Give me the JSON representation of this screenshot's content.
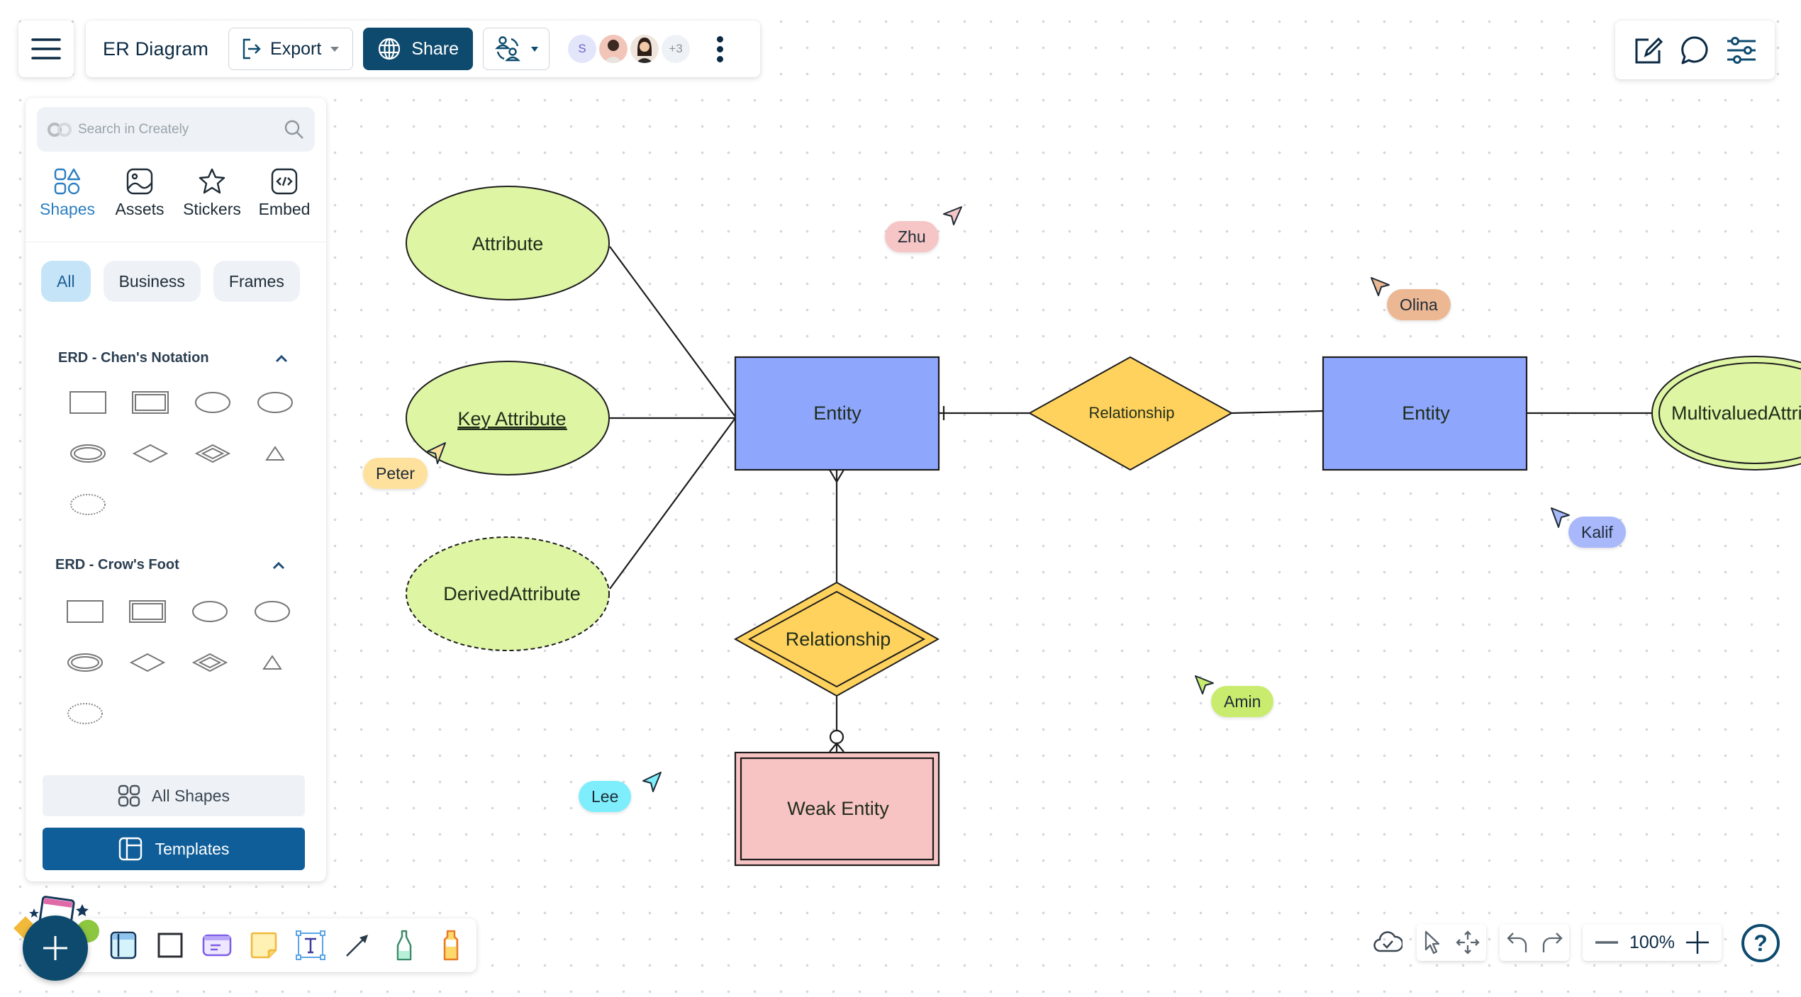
{
  "header": {
    "menu_icon": "hamburger-icon",
    "title": "ER Diagram",
    "export_label": "Export",
    "share_label": "Share",
    "collaborators": [
      {
        "initial": "S",
        "bg": "#e3e6fb",
        "fg": "#6b63c9"
      },
      {
        "initial": "",
        "bg": "#f2c5b9",
        "fg": "#3b2a22"
      },
      {
        "initial": "",
        "bg": "#efe5dc",
        "fg": "#3b2a22"
      },
      {
        "initial": "+3",
        "bg": "#eef2f6",
        "fg": "#8a939b"
      }
    ]
  },
  "right_toolbar": {
    "icons": [
      "edit-icon",
      "comment-icon",
      "settings-sliders-icon"
    ]
  },
  "panel": {
    "search_placeholder": "Search in Creately",
    "tabs": [
      {
        "label": "Shapes",
        "active": true
      },
      {
        "label": "Assets",
        "active": false
      },
      {
        "label": "Stickers",
        "active": false
      },
      {
        "label": "Embed",
        "active": false
      }
    ],
    "chips": [
      {
        "label": "All",
        "active": true
      },
      {
        "label": "Business",
        "active": false
      },
      {
        "label": "Frames",
        "active": false
      }
    ],
    "sections": [
      {
        "title": "ERD - Chen's Notation",
        "expanded": true
      },
      {
        "title": "ERD - Crow's Foot",
        "expanded": true
      }
    ],
    "all_shapes_label": "All Shapes",
    "templates_label": "Templates"
  },
  "diagram": {
    "colors": {
      "attribute": "#def5a4",
      "entity": "#8fa6fd",
      "relationship": "#ffd25e",
      "weak_entity": "#f7c3c3",
      "stroke": "#1d1d1d"
    },
    "shapes": {
      "attribute": "Attribute",
      "key_attribute": "Key Attribute",
      "derived_attribute": "DerivedAttribute",
      "entity_1": "Entity",
      "relationship_1": "Relationship",
      "entity_2": "Entity",
      "multivalued_attribute": "MultivaluedAttribute",
      "relationship_2": "Relationship",
      "weak_entity": "Weak Entity"
    }
  },
  "cursors": [
    {
      "name": "Zhu",
      "color": "#f6c6c6"
    },
    {
      "name": "Olina",
      "color": "#ecb894"
    },
    {
      "name": "Peter",
      "color": "#ffe19e"
    },
    {
      "name": "Kalif",
      "color": "#a9b8fb"
    },
    {
      "name": "Amin",
      "color": "#c9ec6e"
    },
    {
      "name": "Lee",
      "color": "#7eeefc"
    }
  ],
  "bottom_toolbar": {
    "tools": [
      "frame-icon",
      "rectangle-icon",
      "card-icon",
      "sticky-note-icon",
      "text-icon",
      "connector-arrow-icon",
      "pen-icon",
      "highlighter-icon"
    ]
  },
  "bottom_right": {
    "zoom_level": "100%"
  }
}
